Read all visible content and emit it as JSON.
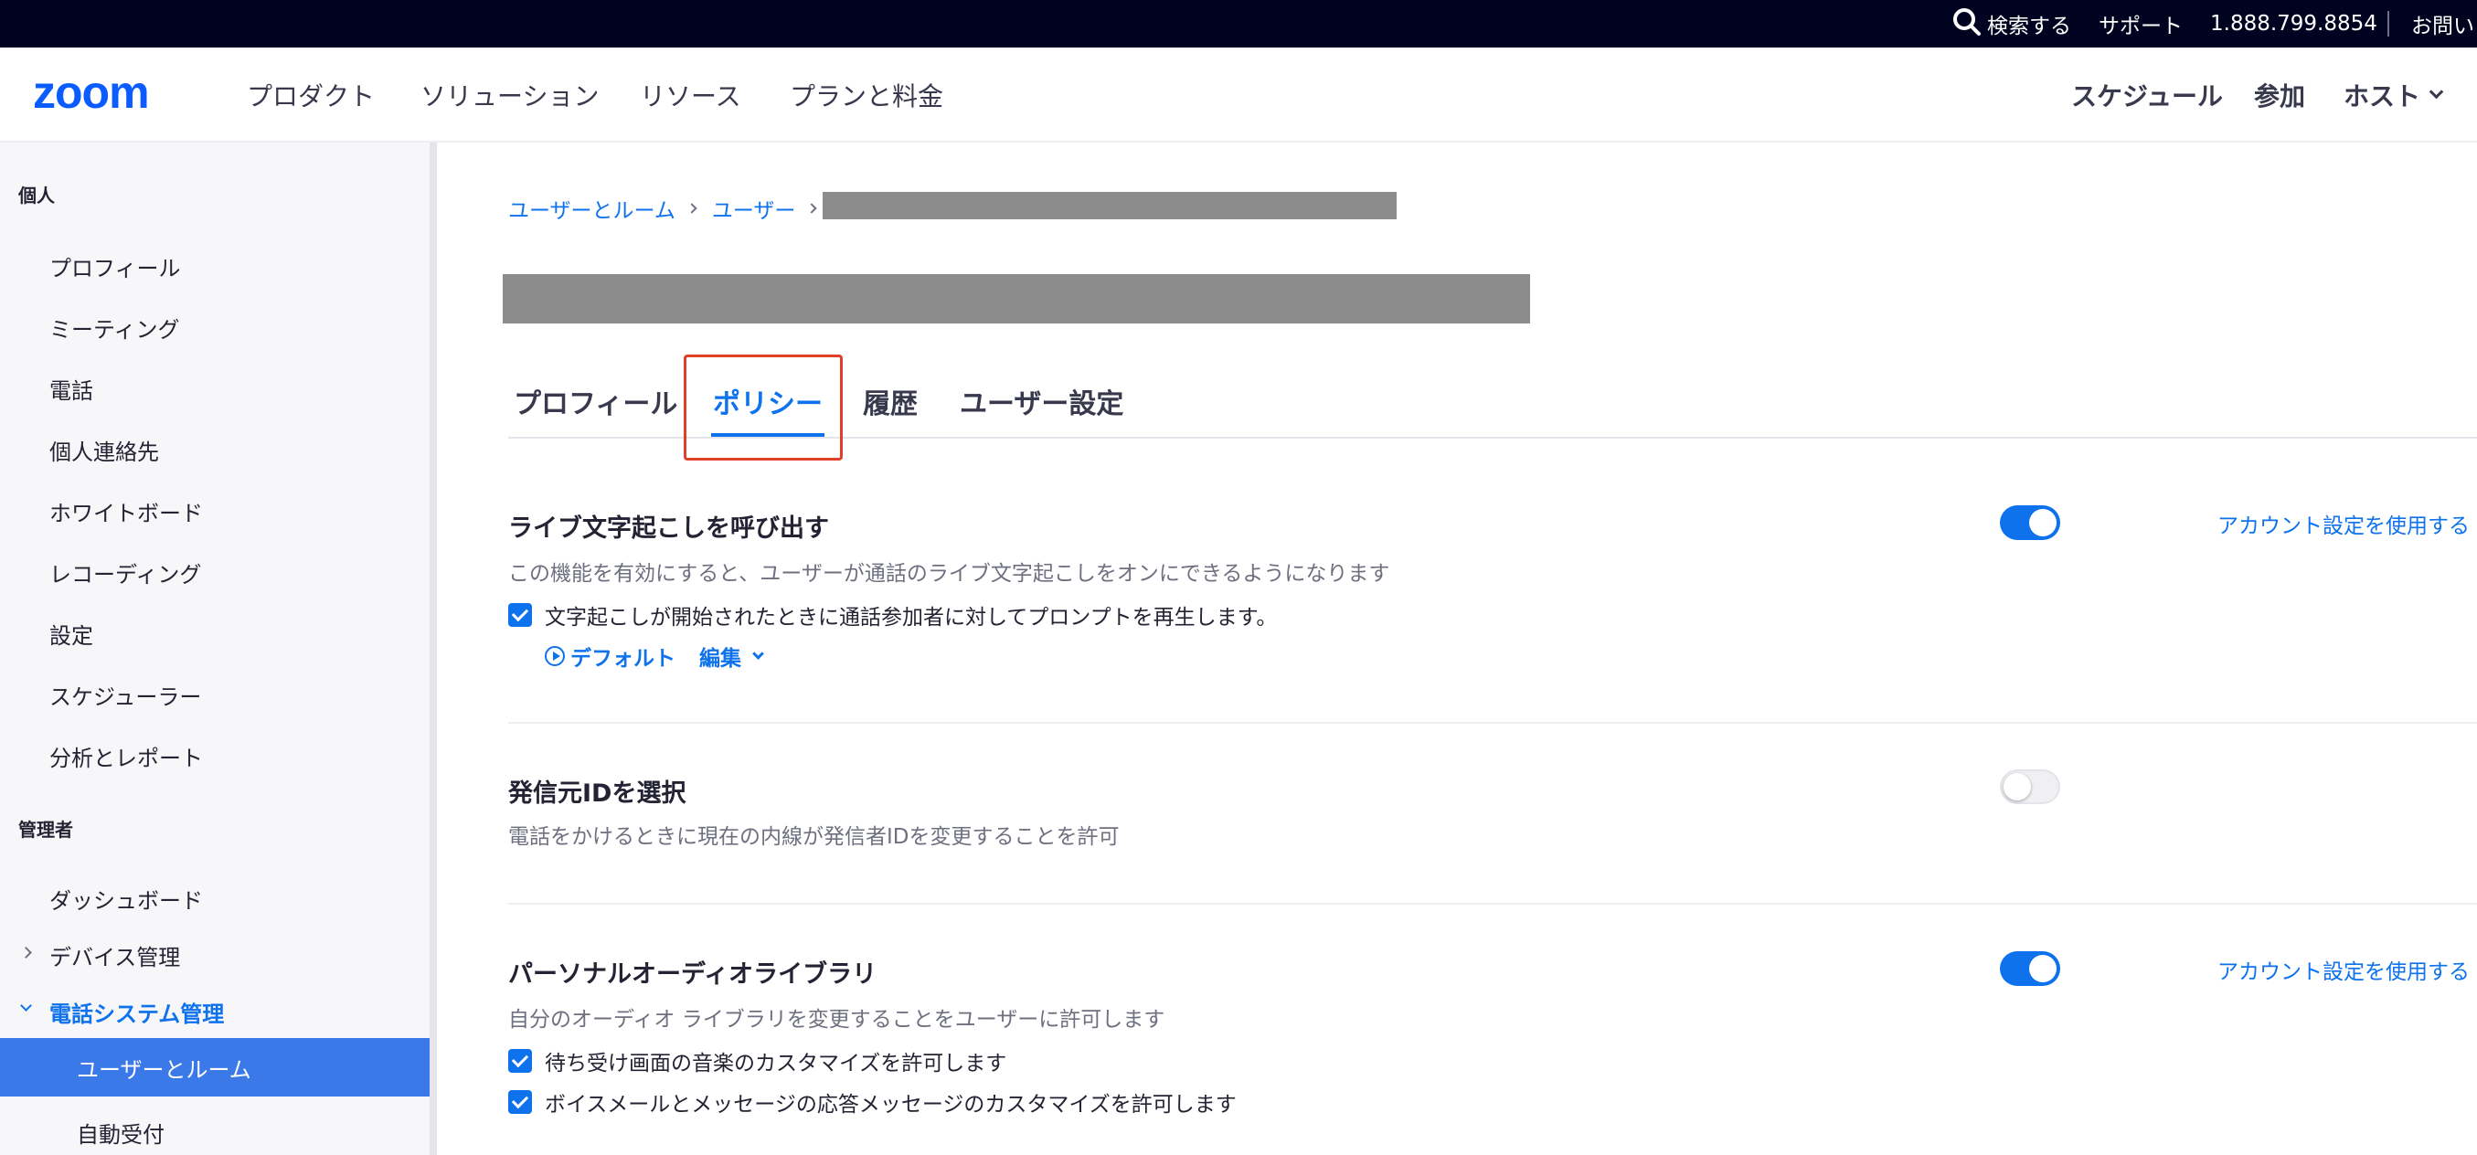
{
  "topbar": {
    "search_label": "検索する",
    "support_label": "サポート",
    "phone": "1.888.799.8854",
    "contact_label": "お問い"
  },
  "nav": {
    "logo_text": "zoom",
    "items": [
      "プロダクト",
      "ソリューション",
      "リソース",
      "プランと料金"
    ],
    "right": {
      "schedule": "スケジュール",
      "join": "参加",
      "host": "ホスト"
    }
  },
  "sidebar": {
    "personal_heading": "個人",
    "personal_items": [
      "プロフィール",
      "ミーティング",
      "電話",
      "個人連絡先",
      "ホワイトボード",
      "レコーディング",
      "設定",
      "スケジューラー",
      "分析とレポート"
    ],
    "admin_heading": "管理者",
    "dashboard": "ダッシュボード",
    "device_mgmt": "デバイス管理",
    "phone_system_mgmt": "電話システム管理",
    "users_rooms": "ユーザーとルーム",
    "auto_receptionist": "自動受付"
  },
  "breadcrumb": {
    "item1": "ユーザーとルーム",
    "item2": "ユーザー"
  },
  "tabs": [
    "プロフィール",
    "ポリシー",
    "履歴",
    "ユーザー設定"
  ],
  "active_tab": "ポリシー",
  "settings": {
    "live_transcription": {
      "title": "ライブ文字起こしを呼び出す",
      "description": "この機能を有効にすると、ユーザーが通話のライブ文字起こしをオンにできるようになります",
      "option": "文字起こしが開始されたときに通話参加者に対してプロンプトを再生します。",
      "default_link": "デフォルト",
      "edit_link": "編集",
      "enabled": true,
      "account_link": "アカウント設定を使用する"
    },
    "caller_id": {
      "title": "発信元IDを選択",
      "description": "電話をかけるときに現在の内線が発信者IDを変更することを許可",
      "enabled": false
    },
    "audio_library": {
      "title": "パーソナルオーディオライブラリ",
      "description": "自分のオーディオ ライブラリを変更することをユーザーに許可します",
      "option1": "待ち受け画面の音楽のカスタマイズを許可します",
      "option2": "ボイスメールとメッセージの応答メッセージのカスタマイズを許可します",
      "enabled": true,
      "account_link": "アカウント設定を使用する"
    }
  },
  "colors": {
    "topbar": "#00031f",
    "accent": "#0e72ed",
    "sidebar_active": "#3b79e8",
    "highlight": "#e0402a"
  }
}
